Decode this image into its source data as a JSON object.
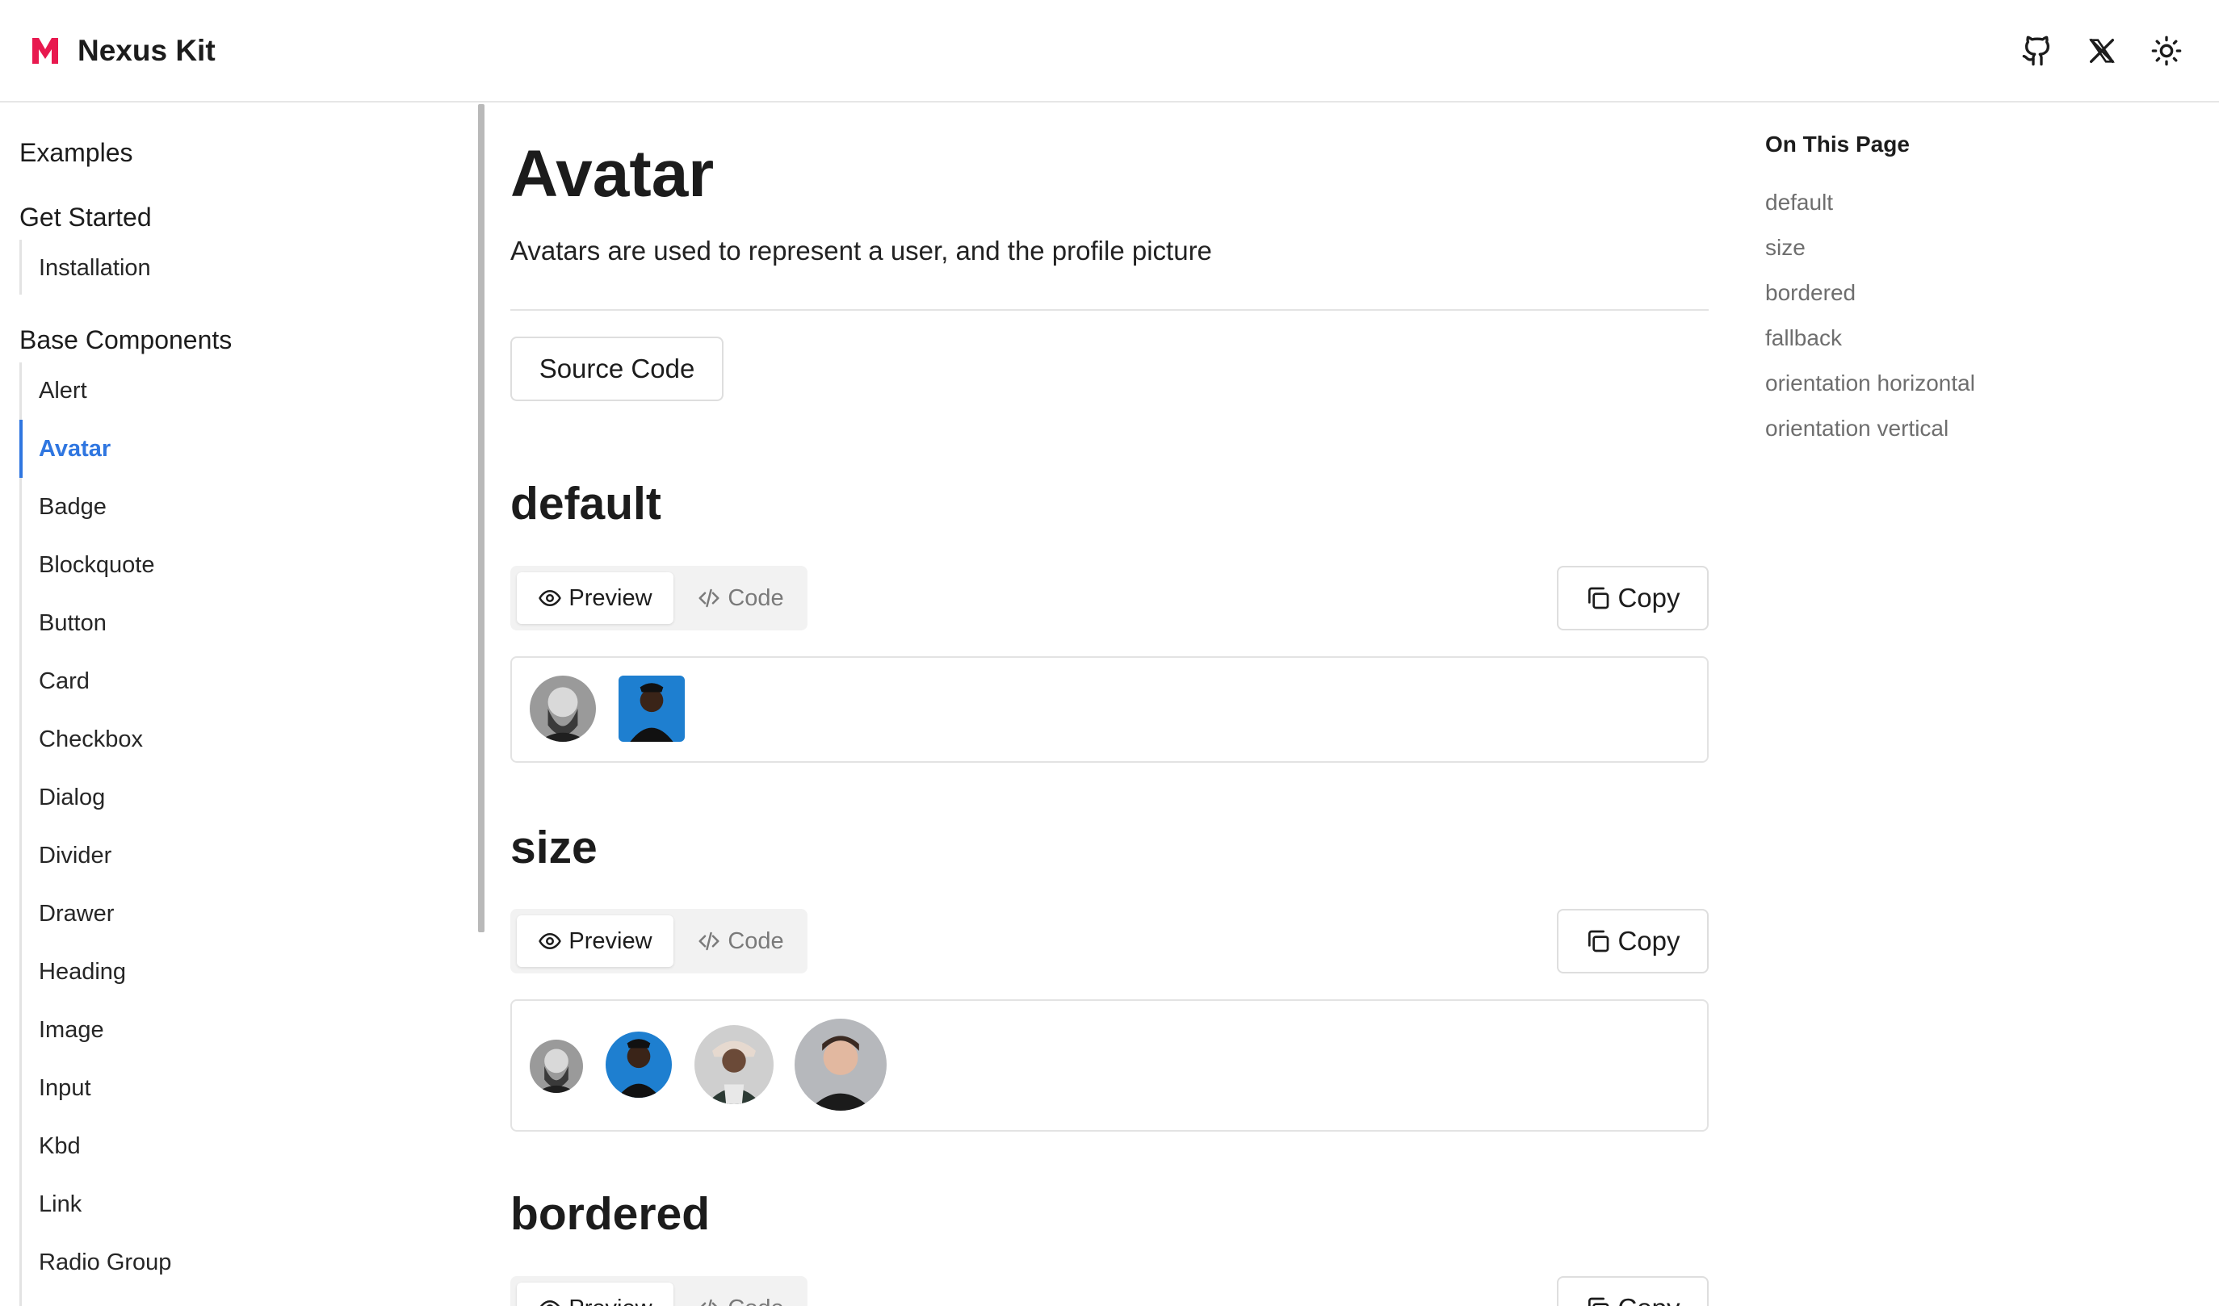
{
  "header": {
    "brand_name": "Nexus Kit",
    "brand_color": "#e8194f",
    "icons": [
      "github-icon",
      "x-twitter-icon",
      "sun-icon"
    ]
  },
  "sidebar": {
    "sections": {
      "examples": "Examples",
      "get_started": "Get Started",
      "base_components": "Base Components"
    },
    "get_started_items": [
      "Installation"
    ],
    "base_items": [
      "Alert",
      "Avatar",
      "Badge",
      "Blockquote",
      "Button",
      "Card",
      "Checkbox",
      "Dialog",
      "Divider",
      "Drawer",
      "Heading",
      "Image",
      "Input",
      "Kbd",
      "Link",
      "Radio Group"
    ],
    "active_item": "Avatar",
    "accent_color": "#2f76e0"
  },
  "main": {
    "title": "Avatar",
    "description": "Avatars are used to represent a user, and the profile picture",
    "source_button": "Source Code",
    "preview_label": "Preview",
    "code_label": "Code",
    "copy_label": "Copy",
    "sections": {
      "default": "default",
      "size": "size",
      "bordered": "bordered"
    }
  },
  "toc": {
    "title": "On This Page",
    "items": [
      "default",
      "size",
      "bordered",
      "fallback",
      "orientation horizontal",
      "orientation vertical"
    ]
  }
}
